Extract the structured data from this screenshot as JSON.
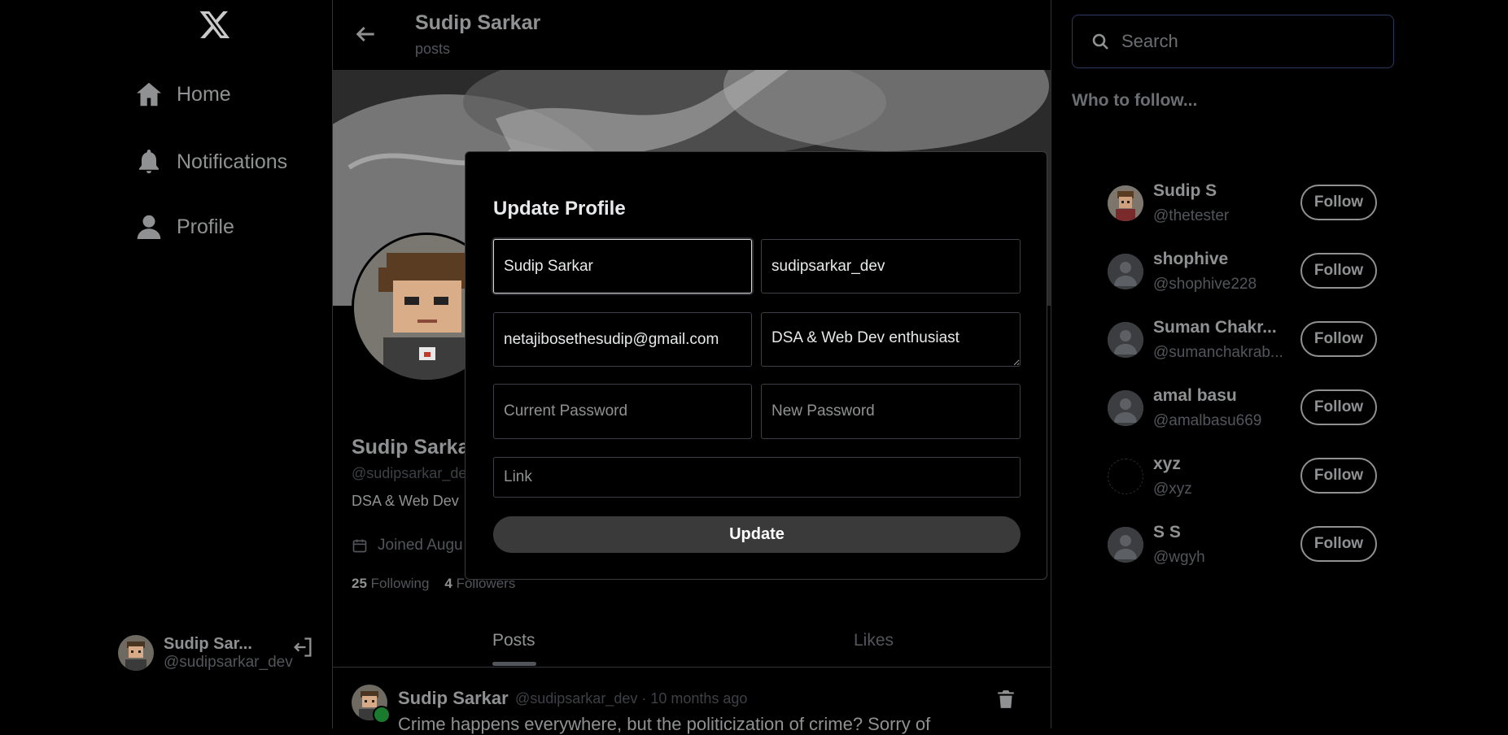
{
  "nav": {
    "items": [
      {
        "label": "Home",
        "icon": "home-icon"
      },
      {
        "label": "Notifications",
        "icon": "bell-icon"
      },
      {
        "label": "Profile",
        "icon": "user-icon"
      }
    ]
  },
  "current_user": {
    "name": "Sudip Sar...",
    "handle": "@sudipsarkar_dev"
  },
  "header": {
    "title": "Sudip Sarkar",
    "subtitle": "posts"
  },
  "profile": {
    "name": "Sudip Sarka",
    "handle": "@sudipsarkar_de",
    "bio": "DSA & Web Dev",
    "joined": "Joined Augu",
    "following_count": "25",
    "following_label": "Following",
    "followers_count": "4",
    "followers_label": "Followers"
  },
  "tabs": [
    {
      "label": "Posts"
    },
    {
      "label": "Likes"
    }
  ],
  "post": {
    "author": "Sudip Sarkar",
    "meta": "@sudipsarkar_dev · 10 months ago",
    "text": "Crime happens everywhere, but the politicization of crime? Sorry of"
  },
  "search": {
    "placeholder": "Search"
  },
  "who_to_follow": {
    "title": "Who to follow...",
    "button_label": "Follow",
    "users": [
      {
        "name": "Sudip S",
        "handle": "@thetester"
      },
      {
        "name": "shophive",
        "handle": "@shophive228"
      },
      {
        "name": "Suman Chakr...",
        "handle": "@sumanchakrab..."
      },
      {
        "name": "amal basu",
        "handle": "@amalbasu669"
      },
      {
        "name": "xyz",
        "handle": "@xyz"
      },
      {
        "name": "S S",
        "handle": "@wgyh"
      }
    ]
  },
  "modal": {
    "title": "Update Profile",
    "fullname_value": "Sudip Sarkar",
    "username_value": "sudipsarkar_dev",
    "email_value": "netajibosethesudip@gmail.com",
    "bio_value": "DSA & Web Dev enthusiast",
    "current_password_placeholder": "Current Password",
    "new_password_placeholder": "New Password",
    "link_placeholder": "Link",
    "submit_label": "Update"
  },
  "colors": {
    "background": "#000000",
    "text_primary": "#e7e9ea",
    "text_muted": "#8f9192",
    "border": "#2f3336",
    "accent_online": "#1a7a2e"
  }
}
